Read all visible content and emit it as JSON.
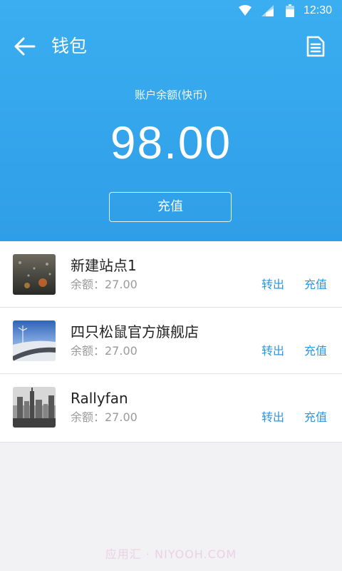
{
  "status_bar": {
    "time": "12:30",
    "icons": [
      "wifi-icon",
      "signal-icon",
      "battery-icon"
    ]
  },
  "toolbar": {
    "title": "钱包",
    "back_icon": "arrow-left-icon",
    "action_icon": "document-icon"
  },
  "balance": {
    "label": "账户余额(快币)",
    "amount": "98.00",
    "recharge_label": "充值"
  },
  "shops": [
    {
      "name": "新建站点1",
      "balance": "余额：27.00",
      "transfer_label": "转出",
      "recharge_label": "充值",
      "image": "rainy-window-thumbnail"
    },
    {
      "name": "四只松鼠官方旗舰店",
      "balance": "余额：27.00",
      "transfer_label": "转出",
      "recharge_label": "充值",
      "image": "road-windmill-thumbnail"
    },
    {
      "name": "Rallyfan",
      "balance": "余额：27.00",
      "transfer_label": "转出",
      "recharge_label": "充值",
      "image": "city-skyline-thumbnail"
    }
  ],
  "watermark": "应用汇 · NIYOOH.COM",
  "colors": {
    "header_blue": "#36a8ee",
    "action_blue": "#2b97e0",
    "muted_text": "#9a9a9a",
    "page_background": "#f2f2f4"
  }
}
